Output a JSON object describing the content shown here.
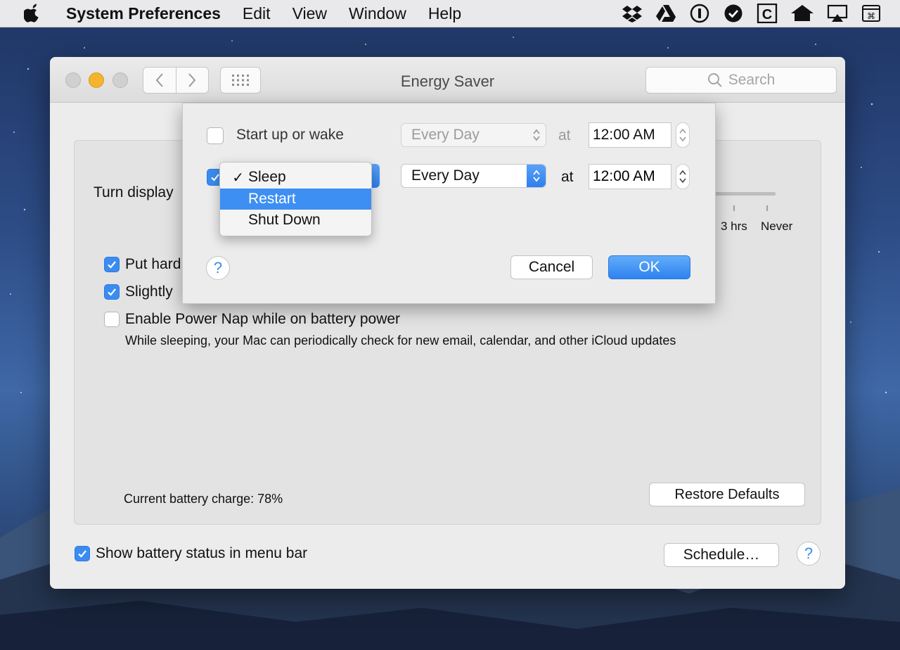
{
  "menubar": {
    "app": "System Preferences",
    "items": [
      "Edit",
      "View",
      "Window",
      "Help"
    ],
    "status_icons": [
      "dropbox-icon",
      "google-drive-icon",
      "1password-icon",
      "checkmark-circle-icon",
      "c-box-icon",
      "home-icon",
      "airplay-icon",
      "keyboard-shortcut-icon"
    ]
  },
  "window": {
    "title": "Energy Saver",
    "search_placeholder": "Search",
    "turn_display_label": "Turn display",
    "slider_ticks": [
      "3 hrs",
      "Never"
    ],
    "options": [
      {
        "label": "Put hard",
        "checked": true
      },
      {
        "label": "Slightly",
        "checked": true
      },
      {
        "label": "Enable Power Nap while on battery power",
        "checked": false
      }
    ],
    "power_nap_description": "While sleeping, your Mac can periodically check for new email, calendar, and other iCloud updates",
    "battery_charge": "Current battery charge: 78%",
    "restore_defaults": "Restore Defaults",
    "show_battery_status": {
      "label": "Show battery status in menu bar",
      "checked": true
    },
    "schedule_button": "Schedule…",
    "help_label": "?"
  },
  "schedule_sheet": {
    "row1": {
      "checked": false,
      "label": "Start up or wake",
      "frequency": "Every Day",
      "at": "at",
      "time": "12:00 AM"
    },
    "row2": {
      "checked": true,
      "frequency": "Every Day",
      "at": "at",
      "time": "12:00 AM"
    },
    "dropdown": {
      "items": [
        {
          "label": "Sleep",
          "checked": true,
          "highlighted": false
        },
        {
          "label": "Restart",
          "checked": false,
          "highlighted": true
        },
        {
          "label": "Shut Down",
          "checked": false,
          "highlighted": false
        }
      ]
    },
    "help_label": "?",
    "cancel": "Cancel",
    "ok": "OK"
  },
  "colors": {
    "accent": "#3a8cf2",
    "traffic_yellow": "#f5b42e"
  }
}
